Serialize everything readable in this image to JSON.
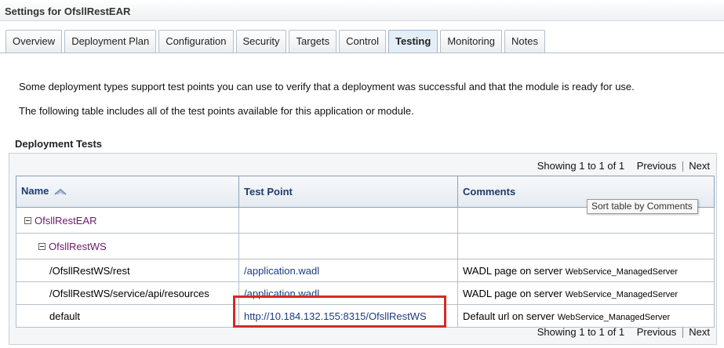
{
  "header": {
    "title": "Settings for OfsllRestEAR"
  },
  "tabs": [
    {
      "label": "Overview"
    },
    {
      "label": "Deployment Plan"
    },
    {
      "label": "Configuration"
    },
    {
      "label": "Security"
    },
    {
      "label": "Targets"
    },
    {
      "label": "Control"
    },
    {
      "label": "Testing",
      "active": true
    },
    {
      "label": "Monitoring"
    },
    {
      "label": "Notes"
    }
  ],
  "intro": {
    "line1": "Some deployment types support test points you can use to verify that a deployment was successful and that the module is ready for use.",
    "line2": "The following table includes all of the test points available for this application or module."
  },
  "section": {
    "title": "Deployment Tests"
  },
  "pager": {
    "showing": "Showing 1 to 1 of 1",
    "previous": "Previous",
    "next": "Next"
  },
  "table": {
    "columns": {
      "name": "Name",
      "test_point": "Test Point",
      "comments": "Comments"
    },
    "rows": [
      {
        "name": "OfsllRestEAR",
        "test_point": "",
        "comments": ""
      },
      {
        "name": "OfsllRestWS",
        "test_point": "",
        "comments": ""
      },
      {
        "name": "/OfsllRestWS/rest",
        "test_point": "/application.wadl",
        "comments_prefix": "WADL page on server",
        "comments_server": "WebService_ManagedServer"
      },
      {
        "name": "/OfsllRestWS/service/api/resources",
        "test_point": "/application.wadl",
        "comments_prefix": "WADL page on server",
        "comments_server": "WebService_ManagedServer"
      },
      {
        "name": "default",
        "test_point": "http://10.184.132.155:8315/OfsllRestWS",
        "comments_prefix": "Default url on server",
        "comments_server": "WebService_ManagedServer"
      }
    ]
  },
  "tooltip": {
    "text": "Sort table by Comments"
  },
  "colors": {
    "header_text": "#1c3c6e",
    "link": "#1c3c82",
    "tree_node": "#6b1b6e",
    "highlight": "#d42a2a"
  }
}
